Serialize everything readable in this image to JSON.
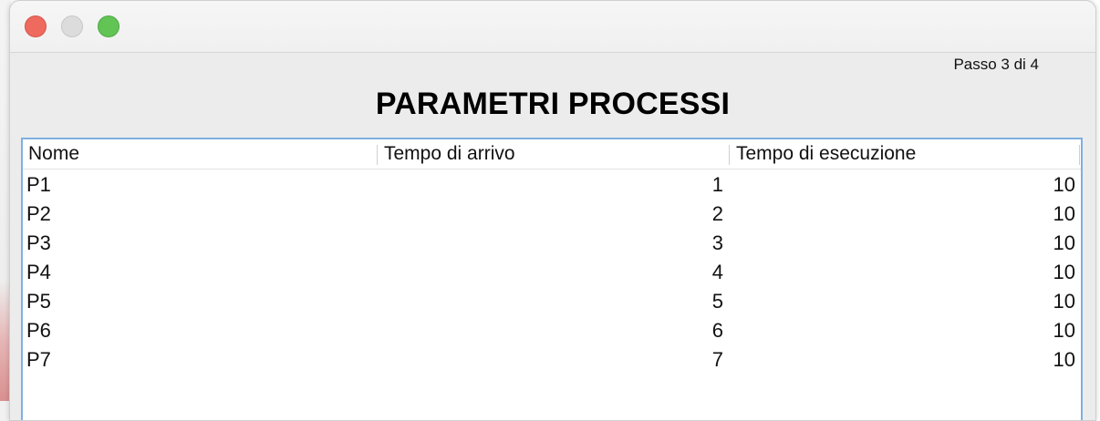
{
  "window": {
    "controls": [
      "close",
      "minimize",
      "zoom"
    ]
  },
  "header": {
    "step": "Passo 3 di 4",
    "title": "PARAMETRI PROCESSI"
  },
  "table": {
    "columns": [
      "Nome",
      "Tempo di arrivo",
      "Tempo di esecuzione"
    ],
    "rows": [
      {
        "name": "P1",
        "arrival": "1",
        "execution": "10"
      },
      {
        "name": "P2",
        "arrival": "2",
        "execution": "10"
      },
      {
        "name": "P3",
        "arrival": "3",
        "execution": "10"
      },
      {
        "name": "P4",
        "arrival": "4",
        "execution": "10"
      },
      {
        "name": "P5",
        "arrival": "5",
        "execution": "10"
      },
      {
        "name": "P6",
        "arrival": "6",
        "execution": "10"
      },
      {
        "name": "P7",
        "arrival": "7",
        "execution": "10"
      }
    ]
  },
  "colors": {
    "close": "#ee6a5f",
    "minimize": "#dcdcdc",
    "zoom": "#61c454",
    "table_border": "#7fb0e0"
  }
}
